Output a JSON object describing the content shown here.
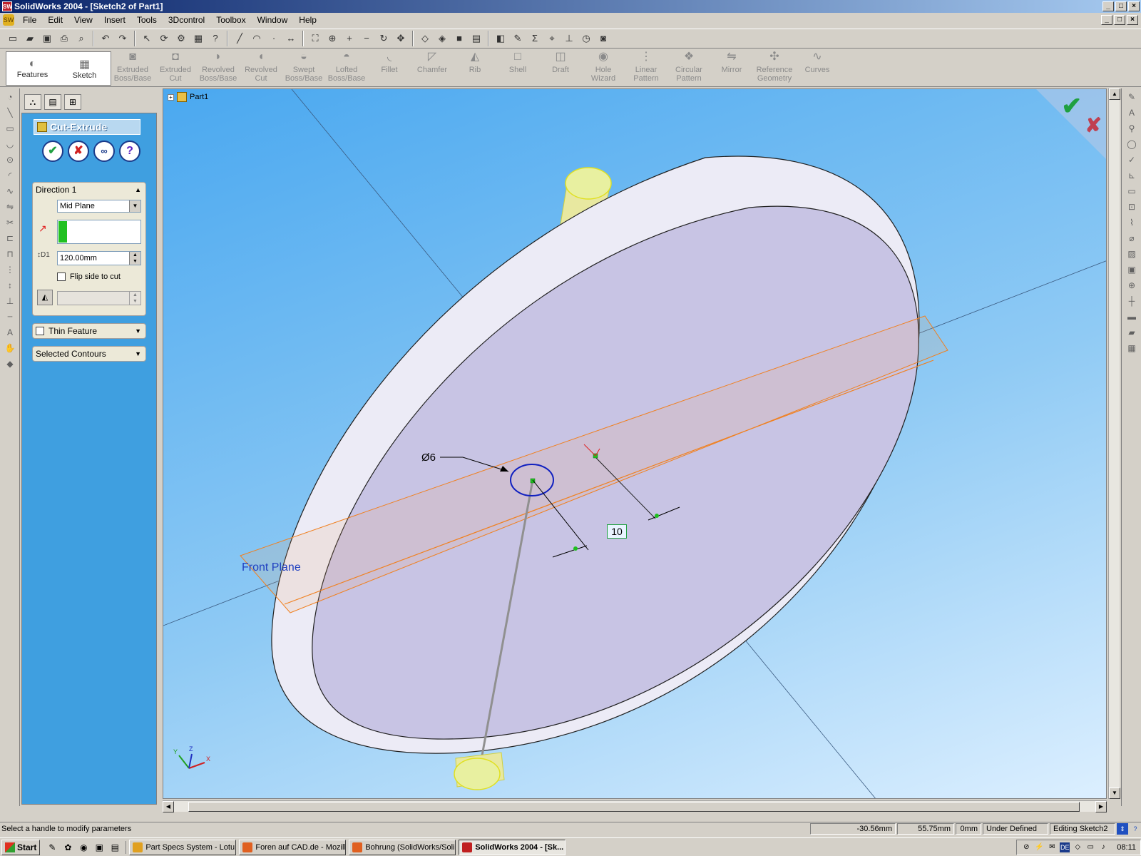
{
  "window": {
    "title": "SolidWorks 2004 - [Sketch2 of Part1]",
    "app_icon": "SW"
  },
  "menu": {
    "items": [
      "File",
      "Edit",
      "View",
      "Insert",
      "Tools",
      "3Dcontrol",
      "Toolbox",
      "Window",
      "Help"
    ]
  },
  "features_toolbar": {
    "tabs": [
      {
        "label": "Features",
        "icon": "features-icon"
      },
      {
        "label": "Sketch",
        "icon": "sketch-grid-icon"
      }
    ],
    "buttons": [
      {
        "label1": "Extruded",
        "label2": "Boss/Base",
        "icon": "extrude-boss-icon"
      },
      {
        "label1": "Extruded",
        "label2": "Cut",
        "icon": "extrude-cut-icon"
      },
      {
        "label1": "Revolved",
        "label2": "Boss/Base",
        "icon": "revolve-boss-icon"
      },
      {
        "label1": "Revolved",
        "label2": "Cut",
        "icon": "revolve-cut-icon"
      },
      {
        "label1": "Swept",
        "label2": "Boss/Base",
        "icon": "sweep-boss-icon"
      },
      {
        "label1": "Lofted",
        "label2": "Boss/Base",
        "icon": "loft-boss-icon"
      },
      {
        "label1": "Fillet",
        "label2": "",
        "icon": "fillet-icon"
      },
      {
        "label1": "Chamfer",
        "label2": "",
        "icon": "chamfer-icon"
      },
      {
        "label1": "Rib",
        "label2": "",
        "icon": "rib-icon"
      },
      {
        "label1": "Shell",
        "label2": "",
        "icon": "shell-icon"
      },
      {
        "label1": "Draft",
        "label2": "",
        "icon": "draft-icon"
      },
      {
        "label1": "Hole",
        "label2": "Wizard",
        "icon": "hole-wizard-icon"
      },
      {
        "label1": "Linear",
        "label2": "Pattern",
        "icon": "linear-pattern-icon"
      },
      {
        "label1": "Circular",
        "label2": "Pattern",
        "icon": "circular-pattern-icon"
      },
      {
        "label1": "Mirror",
        "label2": "",
        "icon": "mirror-icon"
      },
      {
        "label1": "Reference",
        "label2": "Geometry",
        "icon": "reference-geometry-icon"
      },
      {
        "label1": "Curves",
        "label2": "",
        "icon": "curves-icon"
      }
    ]
  },
  "property_manager": {
    "title": "Cut-Extrude",
    "direction1": {
      "title": "Direction 1",
      "end_condition": "Mid Plane",
      "depth_label": "D1",
      "depth": "120.00mm",
      "flip_label": "Flip side to cut",
      "flip_checked": false
    },
    "thin_feature": {
      "label": "Thin Feature",
      "checked": false
    },
    "selected_contours": {
      "label": "Selected Contours"
    }
  },
  "viewport": {
    "tree_root": "Part1",
    "plane_label": "Front Plane",
    "diameter_dim": "Ø6",
    "distance_dim": "10",
    "triad": {
      "x": "X",
      "y": "Y",
      "z": "Z"
    }
  },
  "statusbar": {
    "message": "Select a handle to modify parameters",
    "x": "-30.56mm",
    "y": "55.75mm",
    "z": "0mm",
    "sketch_state": "Under Defined",
    "mode": "Editing Sketch2"
  },
  "taskbar": {
    "start": "Start",
    "tasks": [
      {
        "label": "Part Specs System - Lotu...",
        "color": "#e0a020"
      },
      {
        "label": "Foren auf CAD.de - Mozill...",
        "color": "#e06020"
      },
      {
        "label": "Bohrung (SolidWorks/Soli...",
        "color": "#e06020"
      },
      {
        "label": "SolidWorks 2004 - [Sk...",
        "color": "#c02020",
        "active": true
      }
    ],
    "tray_lang": "DE",
    "clock": "08:11"
  }
}
